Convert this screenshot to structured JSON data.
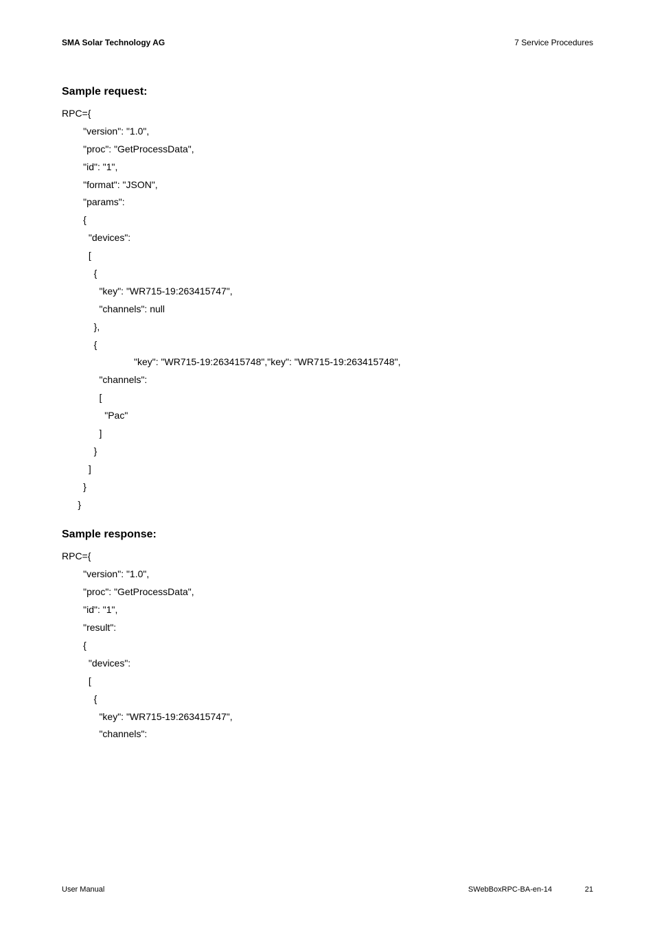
{
  "header": {
    "left": "SMA Solar Technology AG",
    "right": "7  Service Procedures"
  },
  "sections": {
    "request_title": "Sample request:",
    "response_title": "Sample response:"
  },
  "code": {
    "request": "RPC={\n        \"version\": \"1.0\",\n        \"proc\": \"GetProcessData\",\n        \"id\": \"1\",\n        \"format\": \"JSON\",\n        \"params\":\n        {\n          \"devices\":\n          [\n            {\n              \"key\": \"WR715-19:263415747\",\n              \"channels\": null\n            },\n            {\n                           \"key\": \"WR715-19:263415748\",\"key\": \"WR715-19:263415748\",\n              \"channels\":\n              [\n                \"Pac\"\n              ]\n            }\n          ]\n        }\n      }",
    "response": "RPC={\n        \"version\": \"1.0\",\n        \"proc\": \"GetProcessData\",\n        \"id\": \"1\",\n        \"result\":\n        {\n          \"devices\":\n          [\n            {\n              \"key\": \"WR715-19:263415747\",\n              \"channels\":"
  },
  "footer": {
    "left": "User Manual",
    "center": "SWebBoxRPC-BA-en-14",
    "right": "21"
  }
}
